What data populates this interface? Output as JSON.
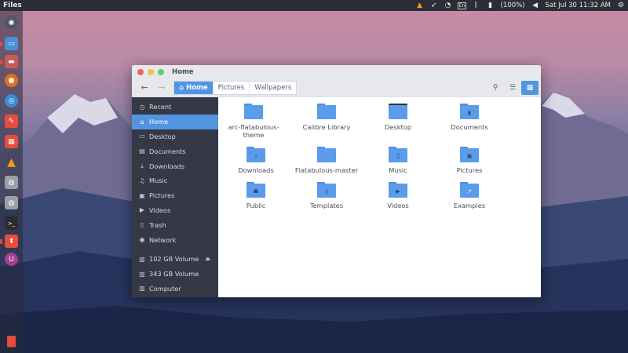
{
  "top_panel": {
    "app_name": "Files",
    "battery": "(100%)",
    "datetime": "Sat Jul 30 11:32 AM"
  },
  "window": {
    "title": "Home",
    "breadcrumbs": [
      "Home",
      "Pictures",
      "Wallpapers"
    ]
  },
  "sidebar": {
    "items": [
      {
        "label": "Recent",
        "icon": "clock-icon"
      },
      {
        "label": "Home",
        "icon": "home-icon"
      },
      {
        "label": "Desktop",
        "icon": "desktop-icon"
      },
      {
        "label": "Documents",
        "icon": "document-icon"
      },
      {
        "label": "Downloads",
        "icon": "download-icon"
      },
      {
        "label": "Music",
        "icon": "music-icon"
      },
      {
        "label": "Pictures",
        "icon": "picture-icon"
      },
      {
        "label": "Videos",
        "icon": "video-icon"
      },
      {
        "label": "Trash",
        "icon": "trash-icon"
      },
      {
        "label": "Network",
        "icon": "network-icon"
      }
    ],
    "devices": [
      {
        "label": "102 GB Volume",
        "icon": "drive-icon"
      },
      {
        "label": "343 GB Volume",
        "icon": "drive-icon"
      },
      {
        "label": "Computer",
        "icon": "computer-icon"
      }
    ]
  },
  "files": [
    {
      "name": "arc-flatabulous-theme",
      "emblem": ""
    },
    {
      "name": "Calibre Library",
      "emblem": ""
    },
    {
      "name": "Desktop",
      "emblem": ""
    },
    {
      "name": "Documents",
      "emblem": "doc"
    },
    {
      "name": "Downloads",
      "emblem": "download"
    },
    {
      "name": "Flatabulous-master",
      "emblem": ""
    },
    {
      "name": "Music",
      "emblem": "music"
    },
    {
      "name": "Pictures",
      "emblem": "picture"
    },
    {
      "name": "Public",
      "emblem": "public"
    },
    {
      "name": "Templates",
      "emblem": "template"
    },
    {
      "name": "Videos",
      "emblem": "video"
    },
    {
      "name": "Examples",
      "emblem": "link"
    }
  ],
  "colors": {
    "accent": "#5294e2",
    "sidebar_bg": "#353945",
    "folder": "#5a9bea"
  }
}
